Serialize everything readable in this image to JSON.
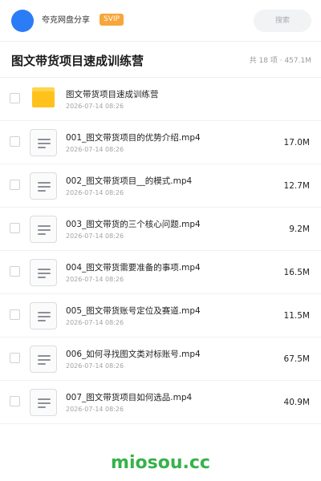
{
  "header": {
    "app_name": "夸克网盘分享",
    "badge": "SVIP",
    "search_placeholder": "搜索"
  },
  "folder": {
    "title": "图文带货项目速成训练营",
    "summary": "共 18 项 · 457.1M"
  },
  "items": [
    {
      "type": "folder",
      "icon": "folder-icon",
      "name": "图文带货项目速成训练营",
      "date": "2026-07-14 08:26",
      "size": ""
    },
    {
      "type": "file",
      "icon": "file-icon",
      "name": "001_图文带货项目的优势介绍.mp4",
      "date": "2026-07-14 08:26",
      "size": "17.0M"
    },
    {
      "type": "file",
      "icon": "file-icon",
      "name": "002_图文带货项目__的模式.mp4",
      "date": "2026-07-14 08:26",
      "size": "12.7M"
    },
    {
      "type": "file",
      "icon": "file-icon",
      "name": "003_图文带货的三个核心问题.mp4",
      "date": "2026-07-14 08:26",
      "size": "9.2M"
    },
    {
      "type": "file",
      "icon": "file-icon",
      "name": "004_图文带货需要准备的事项.mp4",
      "date": "2026-07-14 08:26",
      "size": "16.5M"
    },
    {
      "type": "file",
      "icon": "file-icon",
      "name": "005_图文带货账号定位及赛道.mp4",
      "date": "2026-07-14 08:26",
      "size": "11.5M"
    },
    {
      "type": "file",
      "icon": "file-icon",
      "name": "006_如何寻找图文类对标账号.mp4",
      "date": "2026-07-14 08:26",
      "size": "67.5M"
    },
    {
      "type": "file",
      "icon": "file-icon",
      "name": "007_图文带货项目如何选品.mp4",
      "date": "2026-07-14 08:26",
      "size": "40.9M"
    }
  ],
  "watermark": "miosou.cc",
  "colors": {
    "avatar": "#2b7cf6",
    "svip_badge": "#f6a63a",
    "folder": "#ffc21c",
    "watermark": "#36b24a"
  }
}
